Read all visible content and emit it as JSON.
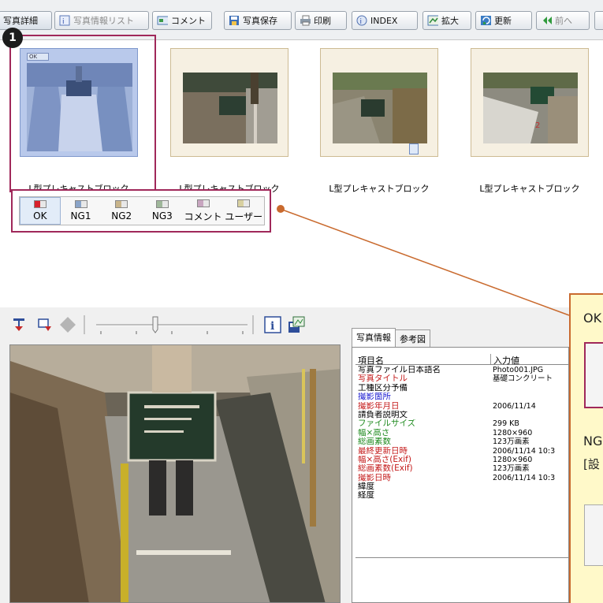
{
  "toolbar": {
    "buttons": [
      {
        "label": "写真詳細",
        "icon": "detail-icon"
      },
      {
        "label": "写真情報リスト",
        "icon": "info-list-icon"
      },
      {
        "label": "コメント",
        "icon": "comment-icon"
      },
      {
        "label": "写真保存",
        "icon": "save-photo-icon"
      },
      {
        "label": "印刷",
        "icon": "print-icon"
      },
      {
        "label": "INDEX",
        "icon": "index-icon"
      },
      {
        "label": "拡大",
        "icon": "zoom-icon"
      },
      {
        "label": "更新",
        "icon": "refresh-icon"
      },
      {
        "label": "前へ",
        "icon": "prev-icon"
      }
    ]
  },
  "thumbnails": [
    {
      "label": "L型プレキャストブロック",
      "selected": true
    },
    {
      "label": "L型プレキャストブロック",
      "selected": false
    },
    {
      "label": "L型プレキャストブロック",
      "selected": false
    },
    {
      "label": "L型プレキャストブロック",
      "selected": false
    }
  ],
  "badge_number": "1",
  "status": {
    "items": [
      {
        "label": "OK",
        "color": "#d8212c"
      },
      {
        "label": "NG1",
        "color": "#8aa4c8"
      },
      {
        "label": "NG2",
        "color": "#c8b48a"
      },
      {
        "label": "NG3",
        "color": "#9fb79a"
      },
      {
        "label": "コメント",
        "color": "#c8a6c0"
      },
      {
        "label": "ユーザー",
        "color": "#d8d0a0"
      }
    ],
    "active_index": 0
  },
  "callout": {
    "line1": "OK",
    "line2": "NG",
    "line3": "[設",
    "accent": "#c96a2e",
    "background": "#fff9c9"
  },
  "info": {
    "tabs": [
      "写真情報",
      "参考図"
    ],
    "columns": [
      "項目名",
      "入力値"
    ],
    "rows": [
      {
        "key": "写真ファイル日本語名",
        "value": "Photo001.JPG",
        "color": "#000000"
      },
      {
        "key": "写真タイトル",
        "value": "基礎コンクリート",
        "color": "#c41a1a"
      },
      {
        "key": "工種区分予備",
        "value": "",
        "color": "#000000"
      },
      {
        "key": "撮影箇所",
        "value": "",
        "color": "#1a1ad0"
      },
      {
        "key": "撮影年月日",
        "value": "2006/11/14",
        "color": "#c41a1a"
      },
      {
        "key": "請負者説明文",
        "value": "",
        "color": "#000000"
      },
      {
        "key": "ファイルサイズ",
        "value": "299 KB",
        "color": "#1e8a1e"
      },
      {
        "key": "幅×高さ",
        "value": "1280×960",
        "color": "#1e8a1e"
      },
      {
        "key": "総画素数",
        "value": "123万画素",
        "color": "#1e8a1e"
      },
      {
        "key": "最終更新日時",
        "value": "2006/11/14 10:3",
        "color": "#c41a1a"
      },
      {
        "key": "幅×高さ(Exif)",
        "value": "1280×960",
        "color": "#c41a1a"
      },
      {
        "key": "総画素数(Exif)",
        "value": "123万画素",
        "color": "#c41a1a"
      },
      {
        "key": "撮影日時",
        "value": "2006/11/14 10:3",
        "color": "#c41a1a"
      },
      {
        "key": "緯度",
        "value": "",
        "color": "#000000"
      },
      {
        "key": "経度",
        "value": "",
        "color": "#000000"
      }
    ]
  }
}
